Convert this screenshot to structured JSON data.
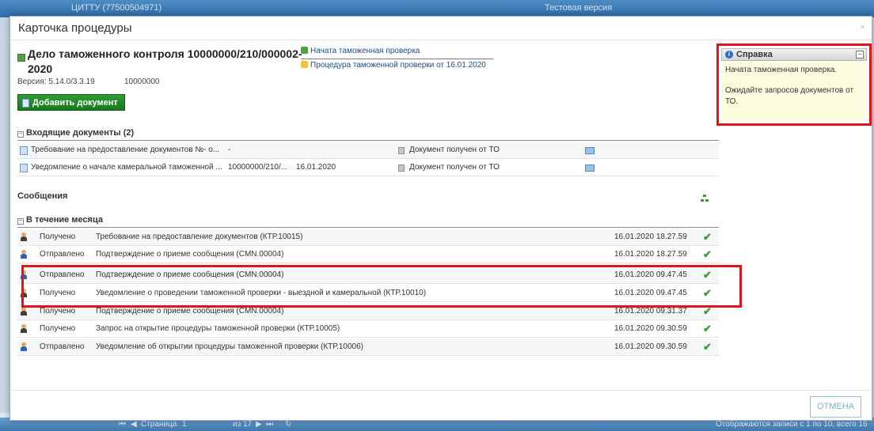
{
  "background": {
    "top_text": "ЦИТТУ (77500504971)",
    "top_version": "Тестовая версия",
    "pager_label": "Страница",
    "pager_page": "1",
    "pager_of": "из 17",
    "records_info": "Отображаются записи с 1 по 10, всего 16"
  },
  "modal": {
    "title": "Карточка процедуры",
    "close_glyph": "×",
    "case_title": "Дело таможенного контроля 10000000/210/000002-2020",
    "version_label": "Версия: 5.14.0/3.3.19",
    "version_code": "10000000",
    "add_document_label": "Добавить документ",
    "status_link": "Начата таможенная проверка",
    "procedure_link": "Процедура таможенной проверки от 16.01.2020",
    "cancel_label": "ОТМЕНА"
  },
  "help": {
    "title": "Справка",
    "info_glyph": "i",
    "collapse_glyph": "−",
    "line1": "Начата таможенная проверка.",
    "line2": "Ожидайте запросов документов от ТО."
  },
  "incoming": {
    "toggle_glyph": "−",
    "header": "Входящие документы (2)",
    "rows": [
      {
        "name": "Требование на предоставление документов №- о...",
        "number": "-",
        "date": "",
        "status": "Документ получен от ТО"
      },
      {
        "name": "Уведомление о начале камеральной таможенной ...",
        "number": "10000000/210/...",
        "date": "16.01.2020",
        "status": "Документ получен от ТО"
      }
    ]
  },
  "messages": {
    "header": "Сообщения",
    "group_toggle_glyph": "−",
    "group_header": "В течение месяца",
    "check_glyph": "✔",
    "rows": [
      {
        "direction": "Получено",
        "text": "Требование на предоставление документов (КТР.10015)",
        "datetime": "16.01.2020 18.27.59"
      },
      {
        "direction": "Отправлено",
        "text": "Подтверждение о приеме сообщения (CMN.00004)",
        "datetime": "16.01.2020 18.27.59"
      },
      {
        "direction": "Отправлено",
        "text": "Подтверждение о приеме сообщения (CMN.00004)",
        "datetime": "16.01.2020 09.47.45"
      },
      {
        "direction": "Получено",
        "text": "Уведомление о проведении таможенной проверки - выездной и камеральной (КТР.10010)",
        "datetime": "16.01.2020 09.47.45"
      },
      {
        "direction": "Получено",
        "text": "Подтверждение о приеме сообщения (CMN.00004)",
        "datetime": "16.01.2020 09.31.37"
      },
      {
        "direction": "Получено",
        "text": "Запрос на открытие процедуры таможенной проверки (КТР.10005)",
        "datetime": "16.01.2020 09.30.59"
      },
      {
        "direction": "Отправлено",
        "text": "Уведомление об открытии процедуры таможенной проверки (КТР.10006)",
        "datetime": "16.01.2020 09.30.59"
      }
    ]
  },
  "colors": {
    "accent_green": "#177a1d",
    "highlight_red": "#e0141b",
    "help_bg": "#fffde0",
    "check_green": "#3d9b35"
  }
}
